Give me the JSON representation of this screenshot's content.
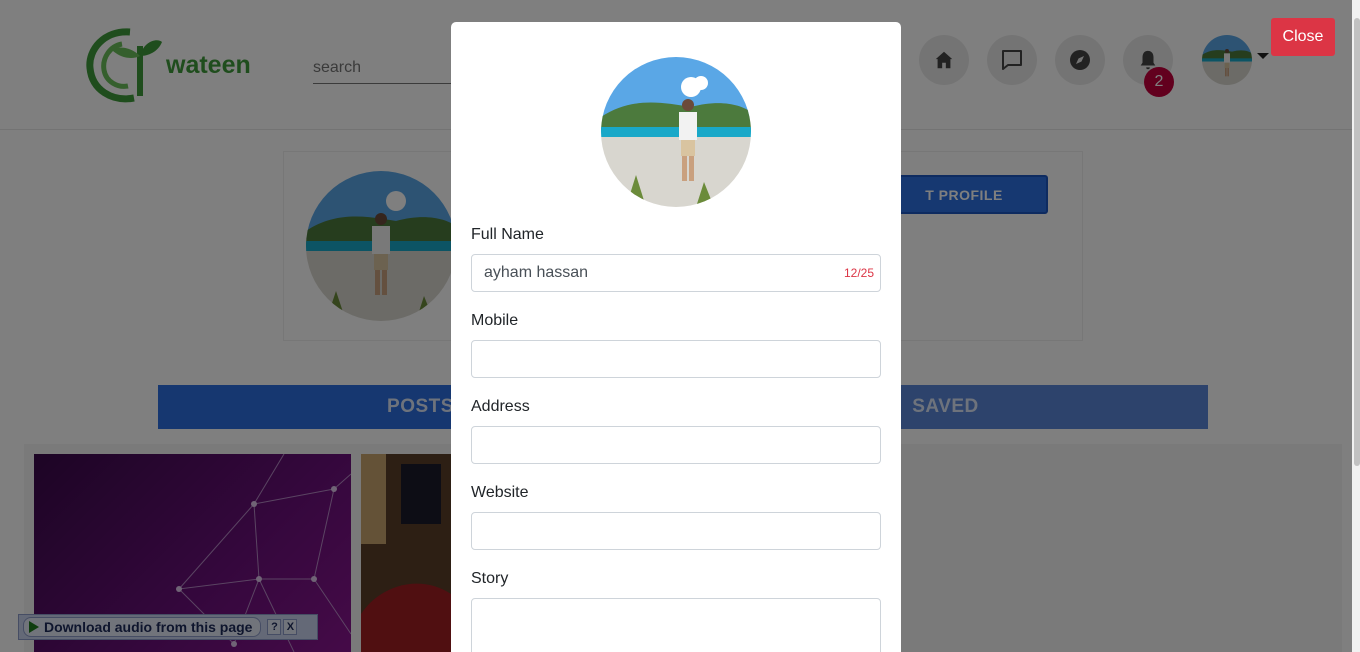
{
  "header": {
    "logo_text": "wateen",
    "search_placeholder": "search",
    "notification_count": "2"
  },
  "profile": {
    "edit_button_label": "T PROFILE"
  },
  "tabs": [
    {
      "label": "POSTS"
    },
    {
      "label": "SAVED"
    }
  ],
  "download_bar": {
    "label": "Download audio from this page",
    "help": "?",
    "close": "X"
  },
  "modal": {
    "fields": {
      "full_name": {
        "label": "Full Name",
        "value": "ayham hassan",
        "counter": "12/25"
      },
      "mobile": {
        "label": "Mobile",
        "value": ""
      },
      "address": {
        "label": "Address",
        "value": ""
      },
      "website": {
        "label": "Website",
        "value": ""
      },
      "story": {
        "label": "Story",
        "value": ""
      }
    },
    "close_label": "Close"
  },
  "colors": {
    "primary": "#2d6ee0",
    "danger": "#dc3545",
    "badge": "#c4003d",
    "brand_green": "#3f9b3a"
  },
  "icons": [
    "home-icon",
    "chat-icon",
    "compass-icon",
    "bell-icon",
    "chevron-down-icon",
    "play-icon"
  ]
}
